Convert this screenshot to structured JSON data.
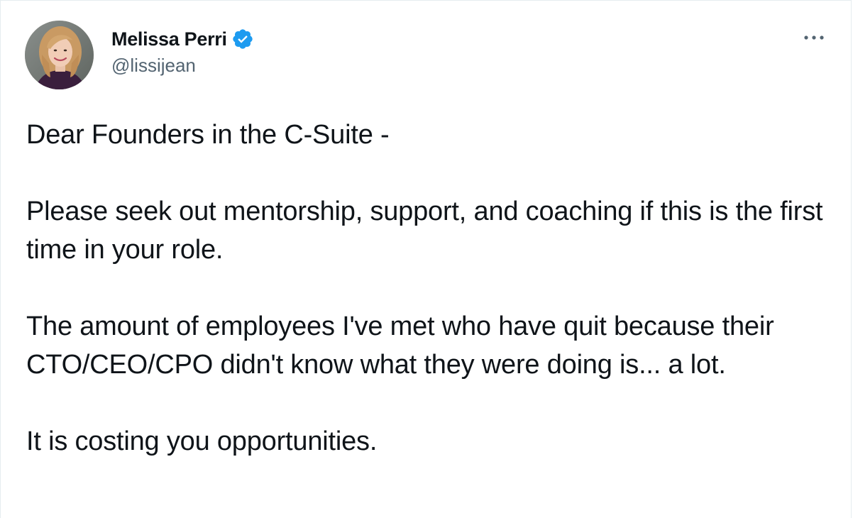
{
  "tweet": {
    "author": {
      "display_name": "Melissa Perri",
      "handle": "@lissijean",
      "verified": true,
      "verified_color": "#1d9bf0"
    },
    "more_icon": "more-horizontal-icon",
    "paragraphs": [
      "Dear Founders in the C-Suite -",
      "Please seek out mentorship, support, and coaching if this is the first time in your role.",
      "The amount of employees I've met who have quit because their CTO/CEO/CPO didn't know what they were doing is... a lot.",
      "It is costing you opportunities."
    ]
  }
}
